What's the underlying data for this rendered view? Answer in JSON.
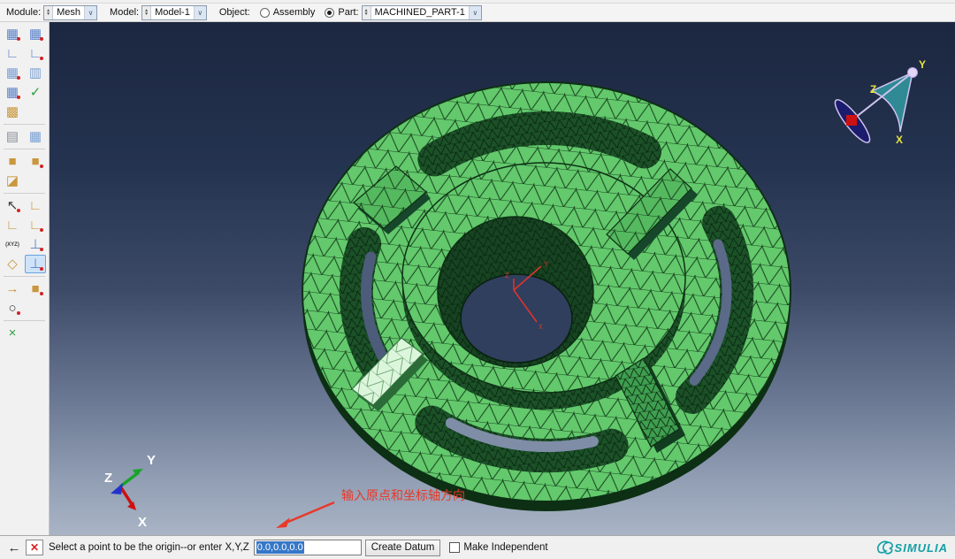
{
  "context_bar": {
    "module_label": "Module:",
    "module_value": "Mesh",
    "model_label": "Model:",
    "model_value": "Model-1",
    "object_label": "Object:",
    "radio_assembly_label": "Assembly",
    "radio_part_label": "Part:",
    "part_value": "MACHINED_PART-1"
  },
  "toolbox": {
    "rows": [
      {
        "icons": [
          {
            "name": "seed-part",
            "glyph": "▦",
            "color": "c-blue",
            "dot": true
          },
          {
            "name": "seed-edges",
            "glyph": "▦",
            "color": "c-blue",
            "dot": true
          }
        ]
      },
      {
        "icons": [
          {
            "name": "delete-part-seeds",
            "glyph": "∟",
            "color": "c-blue"
          },
          {
            "name": "delete-edge-seeds",
            "glyph": "∟",
            "color": "c-blue",
            "dot": true
          }
        ]
      },
      {
        "icons": [
          {
            "name": "mesh-part",
            "glyph": "▦",
            "color": "c-steel",
            "dot": true
          },
          {
            "name": "mesh-region",
            "glyph": "▥",
            "color": "c-steel"
          }
        ]
      },
      {
        "icons": [
          {
            "name": "element-numbering",
            "glyph": "▦",
            "color": "c-blue",
            "dot": true
          },
          {
            "name": "verify-mesh",
            "glyph": "✓",
            "color": "c-green"
          }
        ]
      },
      {
        "icons": [
          {
            "name": "create-mesh-part",
            "glyph": "▩",
            "color": "c-tan"
          }
        ]
      },
      {
        "sep": true
      },
      {
        "icons": [
          {
            "name": "mesh-defaults",
            "glyph": "▤",
            "color": "c-gray"
          },
          {
            "name": "element-type",
            "glyph": "▦",
            "color": "c-steel"
          }
        ]
      },
      {
        "sep": true
      },
      {
        "icons": [
          {
            "name": "bottom-up-mesh",
            "glyph": "■",
            "color": "c-tan"
          },
          {
            "name": "delete-mesh",
            "glyph": "■",
            "color": "c-tan",
            "dot": true
          }
        ]
      },
      {
        "icons": [
          {
            "name": "edit-mesh",
            "glyph": "◪",
            "color": "c-tan"
          }
        ]
      },
      {
        "sep": true
      },
      {
        "icons": [
          {
            "name": "query-tool",
            "glyph": "↖",
            "color": "c-dark",
            "dot": true
          },
          {
            "name": "partition-cell",
            "glyph": "∟",
            "color": "c-tan"
          }
        ]
      },
      {
        "icons": [
          {
            "name": "partition-face",
            "glyph": "∟",
            "color": "c-tan"
          },
          {
            "name": "partition-edge",
            "glyph": "∟",
            "color": "c-tan",
            "dot": true
          }
        ]
      },
      {
        "icons": [
          {
            "name": "datum-point-xyz",
            "glyph": "(XYZ)",
            "color": "c-dark",
            "small": true
          },
          {
            "name": "datum-axis",
            "glyph": "⊥",
            "color": "c-blue",
            "dot": true
          }
        ]
      },
      {
        "icons": [
          {
            "name": "datum-plane",
            "glyph": "◇",
            "color": "c-tan"
          },
          {
            "name": "datum-csys",
            "glyph": "⊥",
            "color": "c-blue",
            "dot": true,
            "selected": true
          }
        ]
      },
      {
        "sep": true
      },
      {
        "icons": [
          {
            "name": "virtual-topology",
            "glyph": "→",
            "color": "c-tan"
          },
          {
            "name": "geometry-edit",
            "glyph": "■",
            "color": "c-tan",
            "dot": true
          }
        ]
      },
      {
        "icons": [
          {
            "name": "edit-mesh-nodes",
            "glyph": "○",
            "color": "c-dark",
            "dot": true
          }
        ]
      },
      {
        "sep": true
      },
      {
        "icons": [
          {
            "name": "misc-tools",
            "glyph": "×",
            "color": "c-green"
          }
        ]
      }
    ]
  },
  "viewport": {
    "annotation": "输入原点和坐标轴方向",
    "csys": {
      "x": "X",
      "y": "Y",
      "z": "Z"
    },
    "triad": {
      "x": "X",
      "y": "Y",
      "z": "Z"
    },
    "compass": {
      "x": "X",
      "y": "Y",
      "z": "Z"
    }
  },
  "prompt_bar": {
    "back_glyph": "←",
    "cancel_glyph": "✕",
    "prompt": "Select a point to be the origin--or enter X,Y,Z",
    "input_value": "0.0,0.0,0.0",
    "create_datum_label": "Create Datum",
    "make_independent_label": "Make Independent",
    "logo_text": "SIMULIA"
  },
  "colors": {
    "mesh_face_green": "#63c96c",
    "mesh_edge_dark": "#15401d",
    "wall_dark_green": "#1c5128",
    "highlight_rib": "#dcf6dc",
    "axis_red": "#e0352b",
    "annotation_red": "#e8392a",
    "compass_teal": "#2f8a96",
    "logo_teal": "#12a0a6"
  }
}
